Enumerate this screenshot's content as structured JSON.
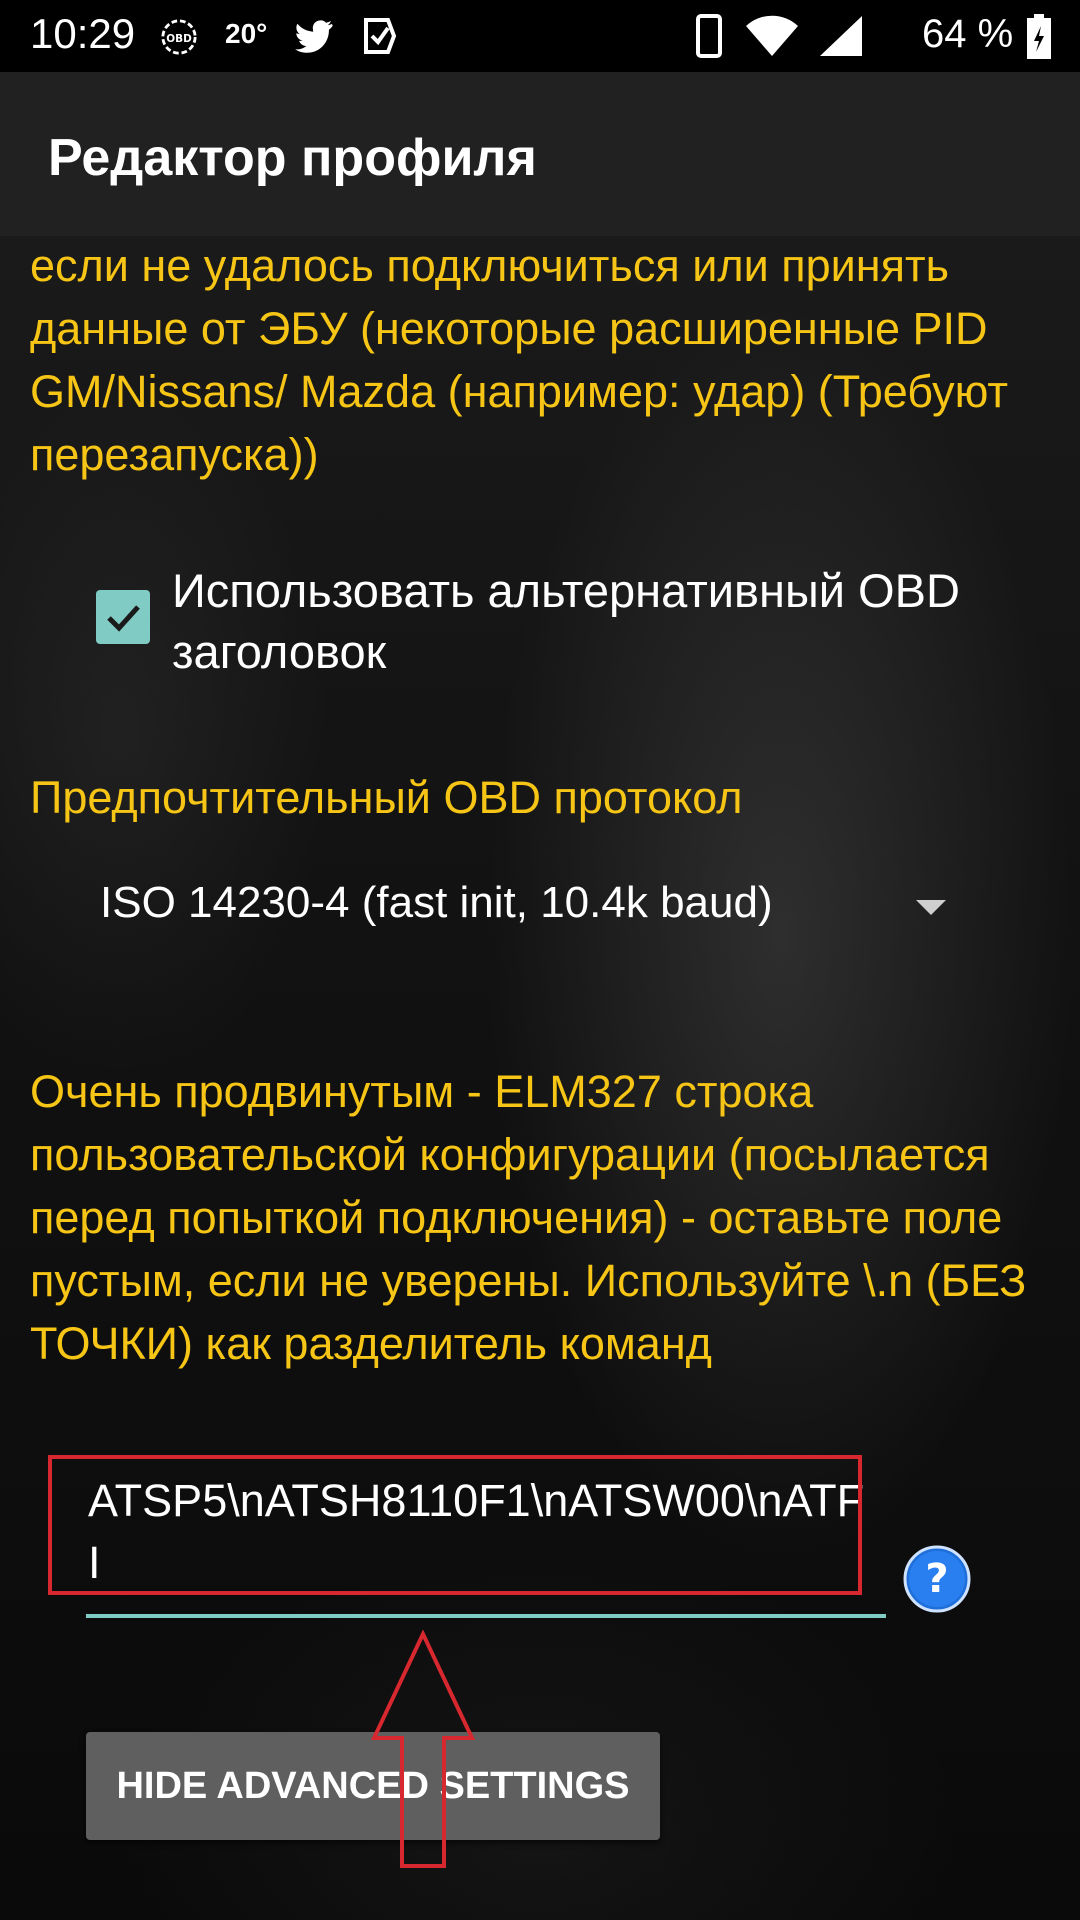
{
  "status_bar": {
    "time": "10:29",
    "temperature": "20°",
    "battery": "64 %"
  },
  "header": {
    "title": "Редактор профиля"
  },
  "content": {
    "retry_note": "если не удалось подключиться или принять данные от ЭБУ (некоторые расширенные PID GM/Nissans/ Mazda (например: удар) (Требуют перезапуска))",
    "alt_header_checkbox": {
      "label": "Использовать альтернативный OBD заголовок",
      "checked": true
    },
    "protocol_label": "Предпочтительный OBD протокол",
    "protocol_value": "ISO 14230-4 (fast init, 10.4k baud)",
    "advanced_description": "Очень продвинутым - ELM327 строка пользовательской конфигурации (посылается перед попыткой подключения) - оставьте поле пустым, если не уверены. Используйте \\.n (БЕЗ ТОЧКИ) как разделитель команд",
    "custom_config_value": "ATSP5\\nATSH8110F1\\nATSW00\\nATFI",
    "hide_button": "HIDE ADVANCED SETTINGS"
  },
  "colors": {
    "accent_yellow": "#f6c515",
    "teal": "#80cbc4",
    "annotation_red": "#d7282f",
    "app_bar": "#212121"
  }
}
